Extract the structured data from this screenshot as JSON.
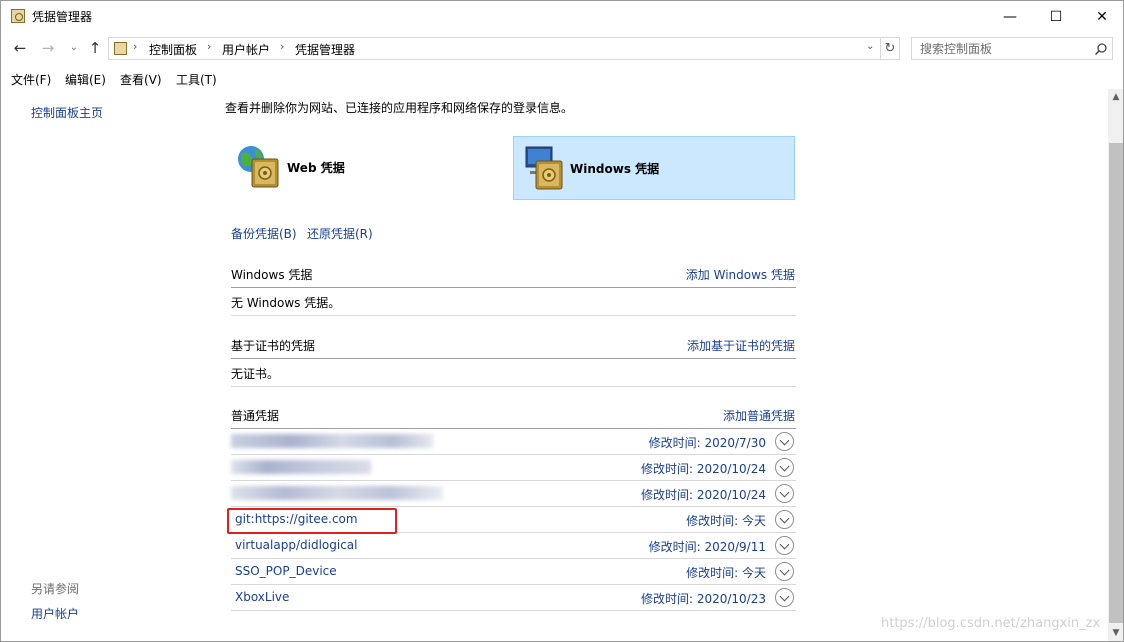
{
  "window": {
    "title": "凭据管理器",
    "minimize_glyph": "—",
    "maximize_glyph": "☐",
    "close_glyph": "✕"
  },
  "address": {
    "breadcrumbs": [
      "控制面板",
      "用户帐户",
      "凭据管理器"
    ],
    "separator": "›",
    "search_placeholder": "搜索控制面板"
  },
  "menu": {
    "items": [
      "文件(F)",
      "编辑(E)",
      "查看(V)",
      "工具(T)"
    ]
  },
  "sidebar": {
    "home_link": "控制面板主页",
    "see_also_heading": "另请参阅",
    "see_also_link": "用户帐户"
  },
  "main": {
    "intro": "查看并删除你为网站、已连接的应用程序和网络保存的登录信息。",
    "tiles": {
      "web_label": "Web 凭据",
      "windows_label": "Windows 凭据"
    },
    "backup_link": "备份凭据(B)",
    "restore_link": "还原凭据(R)",
    "windows_section": {
      "title": "Windows 凭据",
      "add_link": "添加 Windows 凭据",
      "empty_text": "无 Windows 凭据。"
    },
    "cert_section": {
      "title": "基于证书的凭据",
      "add_link": "添加基于证书的凭据",
      "empty_text": "无证书。"
    },
    "generic_section": {
      "title": "普通凭据",
      "add_link": "添加普通凭据",
      "rows": [
        {
          "name": "",
          "modified": "修改时间: 2020/7/30",
          "redacted": true
        },
        {
          "name": "",
          "modified": "修改时间: 2020/10/24",
          "redacted": true
        },
        {
          "name": "",
          "modified": "修改时间: 2020/10/24",
          "redacted": true
        },
        {
          "name": "git:https://gitee.com",
          "modified": "修改时间: 今天",
          "redacted": false
        },
        {
          "name": "virtualapp/didlogical",
          "modified": "修改时间: 2020/9/11",
          "redacted": false
        },
        {
          "name": "SSO_POP_Device",
          "modified": "修改时间: 今天",
          "redacted": false
        },
        {
          "name": "XboxLive",
          "modified": "修改时间: 2020/10/23",
          "redacted": false
        }
      ]
    }
  },
  "watermark": "https://blog.csdn.net/zhangxin_zx",
  "colors": {
    "link": "#1a3e96",
    "selected_tile": "#cce8ff",
    "highlight_box": "#e02020"
  },
  "icons": {
    "back": "arrow-left-icon",
    "forward": "arrow-right-icon",
    "up": "arrow-up-icon",
    "refresh": "refresh-icon",
    "search": "search-icon",
    "expand": "chevron-down-circle-icon"
  }
}
